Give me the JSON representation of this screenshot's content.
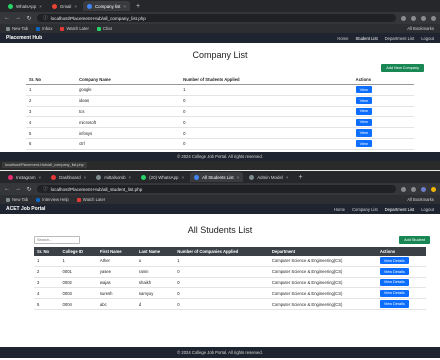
{
  "screen1": {
    "tabs": [
      {
        "label": "WhatsApp",
        "color": "#25d366",
        "active": false
      },
      {
        "label": "Gmail",
        "color": "#ea4335",
        "active": false
      },
      {
        "label": "Company list",
        "color": "#4285f4",
        "active": true
      }
    ],
    "url": "localhost/Placement-Hub/all_company_list.php",
    "bookmarks": [
      {
        "label": "New Tab",
        "color": "#7f8c8d"
      },
      {
        "label": "Inbox",
        "color": "#0a66c2"
      },
      {
        "label": "Watch Later",
        "color": "#e53935"
      },
      {
        "label": "Chat",
        "color": "#25d366"
      }
    ],
    "bookmarks_right": "All Bookmarks",
    "brand": "Placement Hub",
    "nav": [
      {
        "label": "Home",
        "current": false
      },
      {
        "label": "Student List",
        "current": true
      },
      {
        "label": "Department List",
        "current": false
      },
      {
        "label": "Logout",
        "current": false
      }
    ],
    "title": "Company List",
    "add_button": "Add New Company",
    "columns": [
      "Sr. No",
      "Company Name",
      "Number of Students Applied",
      "Actions"
    ],
    "rows": [
      {
        "sr": "1",
        "name": "google",
        "applied": "1",
        "action": "View"
      },
      {
        "sr": "2",
        "name": "ideas",
        "applied": "0",
        "action": "View"
      },
      {
        "sr": "3",
        "name": "tcs",
        "applied": "0",
        "action": "View"
      },
      {
        "sr": "4",
        "name": "microsoft",
        "applied": "0",
        "action": "View"
      },
      {
        "sr": "5",
        "name": "infosys",
        "applied": "0",
        "action": "View"
      },
      {
        "sr": "6",
        "name": "ctrl",
        "applied": "0",
        "action": "View"
      }
    ],
    "footer": "© 2024 College Job Portal. All rights reserved.",
    "status_url": "localhost/Placement-Hub/all_company_list.php"
  },
  "screen2": {
    "tabs": [
      {
        "label": "Instagram",
        "color": "#e1306c",
        "active": false
      },
      {
        "label": "Dashboard",
        "color": "#e53935",
        "active": false
      },
      {
        "label": "mittalsomb",
        "color": "#7f8c8d",
        "active": false
      },
      {
        "label": "(20) WhatsApp",
        "color": "#25d366",
        "active": false
      },
      {
        "label": "All Students List",
        "color": "#4285f4",
        "active": true
      },
      {
        "label": "Admin Model",
        "color": "#7f8c8d",
        "active": false
      }
    ],
    "url": "localhost/Placement-Hub/all_student_list.php",
    "bookmarks": [
      {
        "label": "New Tab",
        "color": "#7f8c8d"
      },
      {
        "label": "Interview Help",
        "color": "#0a66c2"
      },
      {
        "label": "Watch Later",
        "color": "#e53935"
      }
    ],
    "bookmarks_right": "All Bookmarks",
    "brand": "ACET Job Portal",
    "nav": [
      {
        "label": "Home",
        "current": false
      },
      {
        "label": "Company List",
        "current": false
      },
      {
        "label": "Department List",
        "current": true
      },
      {
        "label": "Logout",
        "current": false
      }
    ],
    "title": "All Students List",
    "search_placeholder": "Search...",
    "add_button": "Add Student",
    "columns": [
      "Sr. No",
      "College ID",
      "First Name",
      "Last Name",
      "Number of Companies Applied",
      "Department",
      "Actions"
    ],
    "rows": [
      {
        "sr": "1",
        "cid": "1",
        "first": "Ather",
        "last": "u",
        "applied": "1",
        "dept": "Computer Science & Engineering(CS)",
        "action": "View Details"
      },
      {
        "sr": "2",
        "cid": "0001",
        "first": "yasee",
        "last": "ramn",
        "applied": "0",
        "dept": "Computer Science & Engineering(CS)",
        "action": "View Details"
      },
      {
        "sr": "3",
        "cid": "0002",
        "first": "wajas",
        "last": "shaikh",
        "applied": "0",
        "dept": "Computer Science & Engineering(CS)",
        "action": "View Details"
      },
      {
        "sr": "4",
        "cid": "0003",
        "first": "suresh",
        "last": "samyuy",
        "applied": "0",
        "dept": "Computer Science & Engineering(CS)",
        "action": "View Details"
      },
      {
        "sr": "5",
        "cid": "0004",
        "first": "abc",
        "last": "d",
        "applied": "0",
        "dept": "Computer Science & Engineering(CS)",
        "action": "View Details"
      }
    ],
    "footer": "© 2024 College Job Portal. All rights reserved."
  }
}
